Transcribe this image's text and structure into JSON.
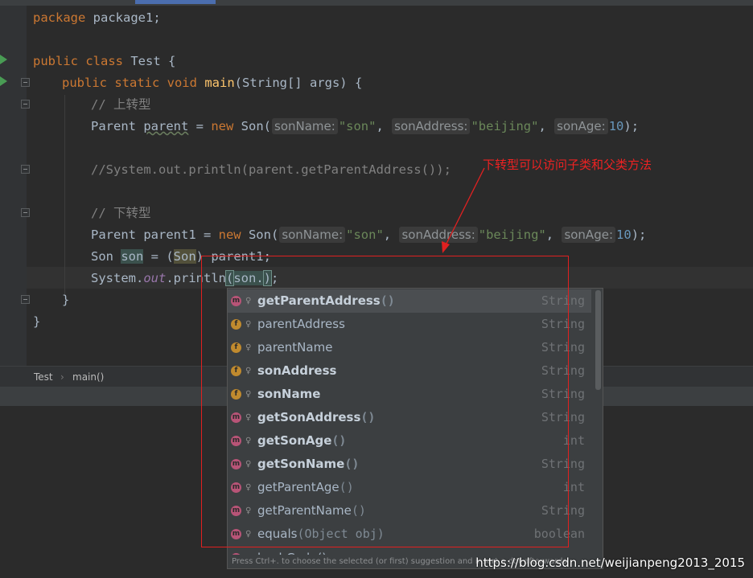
{
  "code": {
    "line1": {
      "kw": "package",
      "rest": " package1;"
    },
    "line3": {
      "kw1": "public",
      "kw2": "class",
      "name": " Test {"
    },
    "line4": {
      "kw": "public static void",
      "method": "main",
      "rest": "(String[] args) {"
    },
    "comment_upcast": "// 上转型",
    "line6": {
      "type": "Parent ",
      "var": "parent",
      "eq": " = ",
      "new": "new",
      "cls": " Son(",
      "hint1": "sonName:",
      "str1": "\"son\"",
      "sep1": ", ",
      "hint2": "sonAddress:",
      "str2": "\"beijing\"",
      "sep2": ", ",
      "hint3": "sonAge:",
      "num": "10",
      "end": ");"
    },
    "commented_call": "//System.out.println(parent.getParentAddress());",
    "comment_downcast": "// 下转型",
    "line11": {
      "type": "Parent parent1 = ",
      "new": "new",
      "cls": " Son(",
      "hint1": "sonName:",
      "str1": "\"son\"",
      "sep1": ", ",
      "hint2": "sonAddress:",
      "str2": "\"beijing\"",
      "sep2": ", ",
      "hint3": "sonAge:",
      "num": "10",
      "end": ");"
    },
    "line12": {
      "a": "Son ",
      "var": "son",
      "b": " = (",
      "cast": "Son",
      "c": ") parent1;"
    },
    "line13": {
      "a": "System.",
      "out": "out",
      "b": ".println",
      "paren": "(",
      "c": "son.",
      "close": ")",
      "end": ";"
    },
    "close1": "}",
    "close2": "}"
  },
  "breadcrumb": {
    "class": "Test",
    "sep": "›",
    "method": "main()"
  },
  "completion": {
    "items": [
      {
        "badge": "m",
        "name": "getParentAddress",
        "params": "()",
        "type": "String",
        "bold": true
      },
      {
        "badge": "f",
        "name": "parentAddress",
        "params": "",
        "type": "String",
        "bold": false
      },
      {
        "badge": "f",
        "name": "parentName",
        "params": "",
        "type": "String",
        "bold": false
      },
      {
        "badge": "f",
        "name": "sonAddress",
        "params": "",
        "type": "String",
        "bold": true
      },
      {
        "badge": "f",
        "name": "sonName",
        "params": "",
        "type": "String",
        "bold": true
      },
      {
        "badge": "m",
        "name": "getSonAddress",
        "params": "()",
        "type": "String",
        "bold": true
      },
      {
        "badge": "m",
        "name": "getSonAge",
        "params": "()",
        "type": "int",
        "bold": true
      },
      {
        "badge": "m",
        "name": "getSonName",
        "params": "()",
        "type": "String",
        "bold": true
      },
      {
        "badge": "m",
        "name": "getParentAge",
        "params": "()",
        "type": "int",
        "bold": false
      },
      {
        "badge": "m",
        "name": "getParentName",
        "params": "()",
        "type": "String",
        "bold": false
      },
      {
        "badge": "m",
        "name": "equals",
        "params": "(Object obj)",
        "type": "boolean",
        "bold": false
      }
    ],
    "partial_item": "hashCode()",
    "footer": "Press Ctrl+. to choose the selected (or first) suggestion and insert a dot afterwards"
  },
  "annotation": "下转型可以访问子类和父类方法",
  "watermark": "https://blog.csdn.net/weijianpeng2013_2015",
  "colors": {
    "keyword": "#cc7832",
    "method": "#ffc66d",
    "string": "#6a8759",
    "number": "#6897bb",
    "comment": "#808080",
    "annotation": "#ee2222"
  }
}
